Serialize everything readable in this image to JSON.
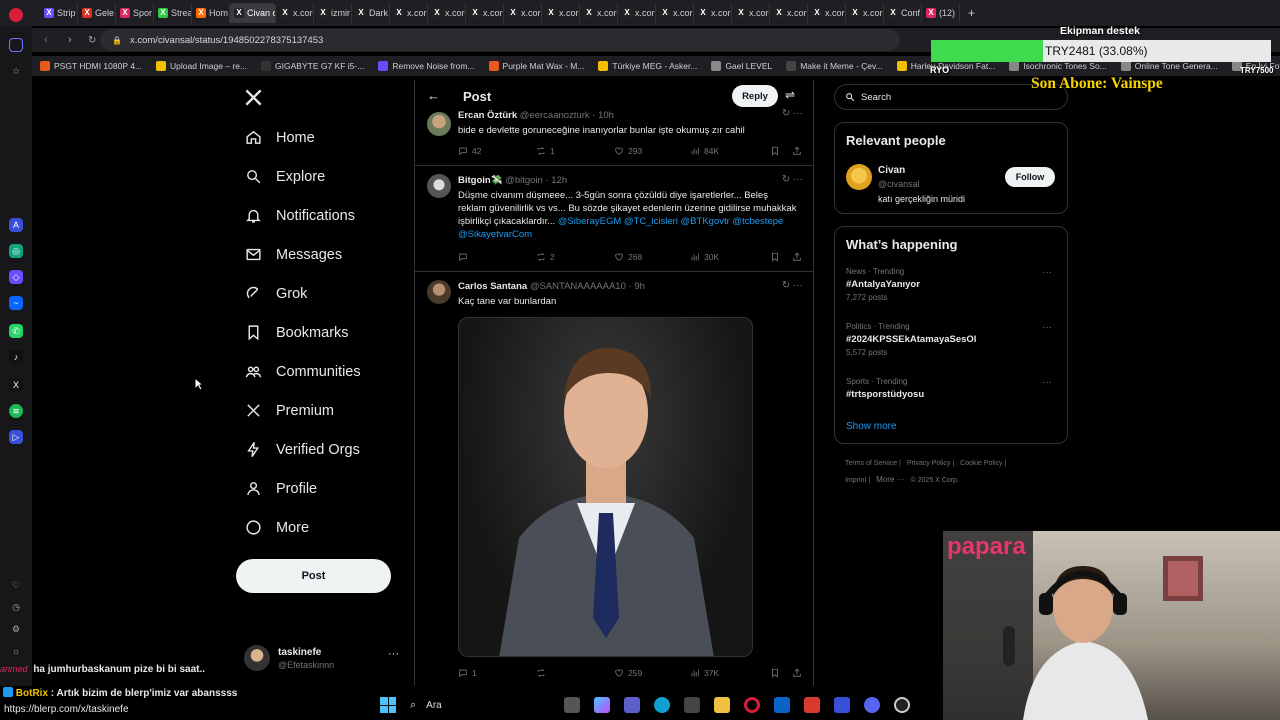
{
  "browser": {
    "tabs": [
      {
        "label": "Strip",
        "color": "#6a4cff"
      },
      {
        "label": "Gele",
        "color": "#d93025"
      },
      {
        "label": "Spor",
        "color": "#e0245e"
      },
      {
        "label": "Strea",
        "color": "#2ecc40"
      },
      {
        "label": "Hom",
        "color": "#ff6a00"
      },
      {
        "label": "Civan on",
        "color": "#222",
        "active": true
      },
      {
        "label": "x.cor",
        "color": "#222"
      },
      {
        "label": "izmir",
        "color": "#222"
      },
      {
        "label": "Dark",
        "color": "#222"
      },
      {
        "label": "x.cor",
        "color": "#222"
      },
      {
        "label": "x.cor",
        "color": "#222"
      },
      {
        "label": "x.cor",
        "color": "#222"
      },
      {
        "label": "x.cor",
        "color": "#222"
      },
      {
        "label": "x.cor",
        "color": "#222"
      },
      {
        "label": "x.cor",
        "color": "#222"
      },
      {
        "label": "x.cor",
        "color": "#222"
      },
      {
        "label": "x.cor",
        "color": "#222"
      },
      {
        "label": "x.cor",
        "color": "#222"
      },
      {
        "label": "x.cor",
        "color": "#222"
      },
      {
        "label": "x.cor",
        "color": "#222"
      },
      {
        "label": "x.cor",
        "color": "#222"
      },
      {
        "label": "x.cor",
        "color": "#222"
      },
      {
        "label": "Conf",
        "color": "#222"
      },
      {
        "label": "(12)",
        "color": "#e0245e"
      }
    ],
    "url": "x.com/civansal/status/1948502278375137453",
    "bookmarks": [
      {
        "label": "PSGT HDMI 1080P 4...",
        "color": "#e85a1a"
      },
      {
        "label": "Upload Image – re...",
        "color": "#f0c000"
      },
      {
        "label": "GIGABYTE G7 KF i5-...",
        "color": "#333"
      },
      {
        "label": "Remove Noise from...",
        "color": "#6a4cff"
      },
      {
        "label": "Purple Mat Wax - M...",
        "color": "#e85a1a"
      },
      {
        "label": "Türkiye MEG - Asker...",
        "color": "#f0c000"
      },
      {
        "label": "Gael LEVEL",
        "color": "#888"
      },
      {
        "label": "Make it Meme - Çev...",
        "color": "#444"
      },
      {
        "label": "Harley-Davidson Fat...",
        "color": "#f0c000"
      },
      {
        "label": "Isochronic Tones So...",
        "color": "#888"
      },
      {
        "label": "Online Tone Genera...",
        "color": "#888"
      },
      {
        "label": "En İyi Fotoğraf ve Vi...",
        "color": "#888"
      }
    ]
  },
  "nav": {
    "items": [
      {
        "label": "Home",
        "icon": "home-icon"
      },
      {
        "label": "Explore",
        "icon": "search-icon"
      },
      {
        "label": "Notifications",
        "icon": "bell-icon"
      },
      {
        "label": "Messages",
        "icon": "envelope-icon"
      },
      {
        "label": "Grok",
        "icon": "grok-icon"
      },
      {
        "label": "Bookmarks",
        "icon": "bookmark-icon"
      },
      {
        "label": "Communities",
        "icon": "people-icon"
      },
      {
        "label": "Premium",
        "icon": "x-logo-icon"
      },
      {
        "label": "Verified Orgs",
        "icon": "lightning-icon"
      },
      {
        "label": "Profile",
        "icon": "person-icon"
      },
      {
        "label": "More",
        "icon": "more-circle-icon"
      }
    ],
    "post_button": "Post",
    "account": {
      "name": "taskinefe",
      "handle": "@Efetaskinnn",
      "menu": "···"
    }
  },
  "main": {
    "header_title": "Post",
    "reply_button": "Reply",
    "tweets": [
      {
        "name": "Ercan Öztürk",
        "handle": "@eercaanozturk · 10h",
        "text": "bide e devlette goruneceğine inanıyorlar bunlar işte okumuş zır cahil",
        "replies": "42",
        "reposts": "1",
        "likes": "293",
        "views": "84K"
      },
      {
        "name": "Bitgoin💸",
        "handle": "@bitgoin · 12h",
        "text": "Düşme civanım düşmeee... 3-5gün sonra çözüldü diye işaretlerler... Beleş reklam güvenilirlik vs vs... Bu sözde şikayet edenlerin üzerine gidilirse muhakkak işbirlikçi çıkacaklardır...",
        "mentions1": "@SiberayEGM @TC_icisleri @BTKgovtr",
        "mentions2": "@tcbestepe @SikayetvarCom",
        "replies": "",
        "reposts": "2",
        "likes": "268",
        "views": "30K"
      },
      {
        "name": "Carlos Santana",
        "handle": "@SANTANAAAAAA10 · 9h",
        "text": "Kaç tane var bunlardan",
        "replies": "1",
        "reposts": "",
        "likes": "259",
        "views": "37K"
      }
    ]
  },
  "right": {
    "search_placeholder": "Search",
    "relevant_title": "Relevant people",
    "person": {
      "name": "Civan",
      "handle": "@civansal",
      "bio": "katı gerçekliğin müridi",
      "follow": "Follow"
    },
    "happening_title": "What’s happening",
    "trends": [
      {
        "meta": "News · Trending",
        "name": "#AntalyaYanıyor",
        "count": "7,272 posts"
      },
      {
        "meta": "Politics · Trending",
        "name": "#2024KPSSEkAtamayaSesOl",
        "count": "5,572 posts"
      },
      {
        "meta": "Sports · Trending",
        "name": "#trtsporstüdyosu",
        "count": ""
      }
    ],
    "show_more": "Show more",
    "footer": {
      "line1": [
        "Terms of Service",
        "Privacy Policy",
        "Cookie Policy"
      ],
      "imprint": "Imprint",
      "more": "More ···",
      "copyright": "© 2025 X Corp."
    }
  },
  "overlay": {
    "donate_title": "Ekipman destek",
    "donate_amount": "TRY2481 (33.08%)",
    "donate_progress": 0.3308,
    "donate_min": "RYO",
    "donate_max": "TRY7500",
    "sub_label": "Son Abone: Vainspe",
    "sponsor": "papara"
  },
  "chat": [
    {
      "user": "",
      "text": "ha jumhurbaskanum pize bi bi saat..",
      "user_color": "#e0245e"
    },
    {
      "user": "BotRix",
      "text": ": Artık bizim de blerp'imiz var abanssss",
      "user_color": "#f0c000"
    }
  ],
  "status_url": "https://blerp.com/x/taskinefe",
  "taskbar": {
    "search": "Ara"
  }
}
